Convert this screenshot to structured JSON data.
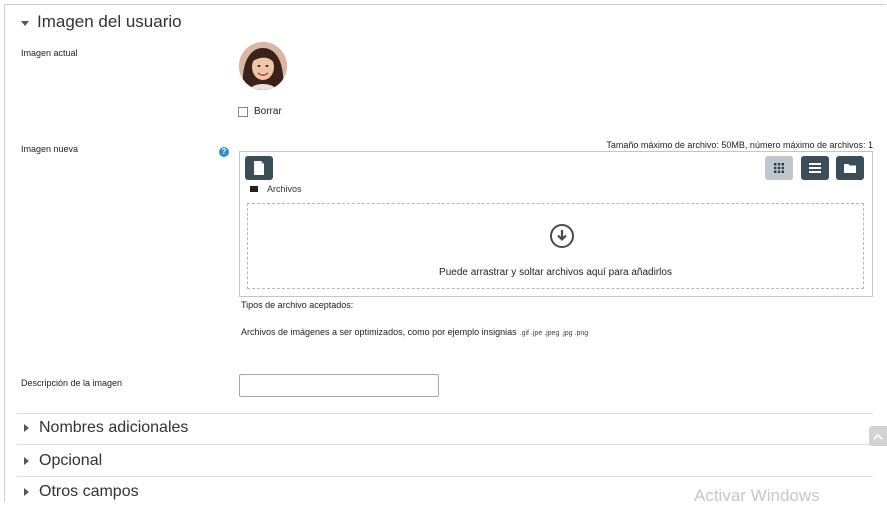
{
  "section": {
    "title": "Imagen del usuario"
  },
  "current_image": {
    "label": "Imagen actual",
    "delete_label": "Borrar"
  },
  "new_image": {
    "label": "Imagen nueva",
    "limits": "Tamaño máximo de archivo: 50MB, número máximo de archivos: 1",
    "path_label": "Archivos",
    "drop_text": "Puede arrastrar y soltar archivos aquí para añadirlos",
    "accepted_title": "Tipos de archivo aceptados:",
    "accepted_desc": "Archivos de imágenes a ser optimizados, como por ejemplo insignias",
    "accepted_ext": ".gif .jpe .jpeg .jpg .png"
  },
  "description": {
    "label": "Descripción de la imagen",
    "value": ""
  },
  "collapsed_sections": [
    "Nombres adicionales",
    "Opcional",
    "Otros campos"
  ],
  "watermark": "Activar Windows",
  "colors": {
    "dark_button": "#3b4d57",
    "active_button": "#bfc6cc",
    "help_icon": "#2a8fd0"
  }
}
